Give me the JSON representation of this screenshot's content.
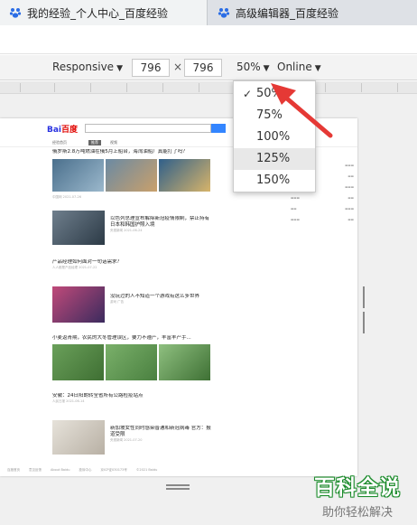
{
  "tabs": [
    {
      "title": "我的经验_个人中心_百度经验"
    },
    {
      "title": "高级编辑器_百度经验"
    }
  ],
  "device_toolbar": {
    "device": "Responsive",
    "width": "796",
    "times": "×",
    "height": "796",
    "zoom": "50%",
    "throttle": "Online"
  },
  "zoom_menu": {
    "options": [
      "50%",
      "75%",
      "100%",
      "125%",
      "150%"
    ],
    "selected": "50%",
    "highlighted": "125%"
  },
  "page": {
    "logo_left": "Bai",
    "logo_right": "百度",
    "nav_tabs": [
      "经验首页",
      "推荐",
      "视频"
    ],
    "articles": [
      {
        "title": "俄罗斯2.8万吨燃油在俄5月上船台，海湾油船厂真能打了吗？",
        "meta": "中国网  2021-07-26"
      },
      {
        "title": "以色列总理宣布解除新冠疫情限制，禁止持有日本和韩国护照入境",
        "meta": "央视新闻  2021-06-24"
      },
      {
        "title": "产品经理如何面对一句话需求？",
        "meta": "人人都是产品经理  2021-07-22"
      },
      {
        "title": "没玩过的人不知道一个游戏有这么多世界",
        "meta": "游戏  广告"
      },
      {
        "title": "小麦返青期，农民的大冬管理误区，要力不遵产，丰富丰产手...",
        "meta": "农业科技  2021-07-26"
      },
      {
        "title": "安徽：24日阳朗转全省所有公路检疫站点",
        "meta": "人民日报  2021-06-14"
      },
      {
        "title": "新加坡女性同时感染普通和新冠病毒 官方：报道受限",
        "meta": "央视新闻  2021-07-20"
      }
    ],
    "footer": [
      "百度首页",
      "意见反馈",
      "About Baidu",
      "投诉中心",
      "京ICP证030173号",
      "©2021 Baidu"
    ]
  },
  "watermark": {
    "title": "百科全说",
    "subtitle": "助你轻松解决"
  },
  "colors": {
    "arrow_red": "#e53935",
    "watermark_green": "#1c8c2c",
    "baidu_red": "#e10602",
    "baidu_blue": "#2932e1"
  }
}
